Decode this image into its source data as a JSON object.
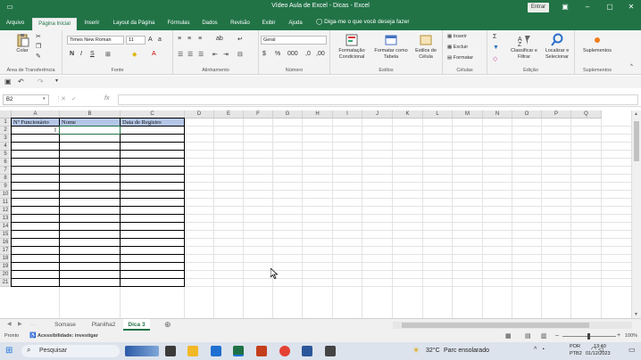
{
  "window": {
    "title": "Vídeo Aula de Excel - Dicas  -  Excel",
    "signin": "Entrar"
  },
  "ribbon_tabs": [
    "Arquivo",
    "Página Inicial",
    "Inserir",
    "Layout da Página",
    "Fórmulas",
    "Dados",
    "Revisão",
    "Exibir",
    "Ajuda"
  ],
  "tell_me": "Diga-me o que você deseja fazer",
  "ribbon": {
    "clipboard": {
      "paste": "Colar",
      "label": "Área de Transferência"
    },
    "font": {
      "name": "Times New Roman",
      "size": "11",
      "bold": "N",
      "italic": "I",
      "underline": "S",
      "label": "Fonte"
    },
    "alignment": {
      "label": "Alinhamento"
    },
    "number": {
      "format": "Geral",
      "label": "Número"
    },
    "styles": {
      "cond": "Formatação Condicional",
      "table": "Formatar como Tabela",
      "cell": "Estilos de Célula",
      "label": "Estilos"
    },
    "cells": {
      "insert": "Inserir",
      "delete": "Excluir",
      "format": "Formatar",
      "label": "Células"
    },
    "editing": {
      "sort": "Classificar e Filtrar",
      "find": "Localizar e Selecionar",
      "label": "Edição"
    },
    "addins": {
      "btn": "Suplementos",
      "label": "Suplementos"
    }
  },
  "name_box": "B2",
  "fx": "fx",
  "columns": [
    "A",
    "B",
    "C",
    "D",
    "E",
    "F",
    "G",
    "H",
    "I",
    "J",
    "K",
    "L",
    "M",
    "N",
    "O",
    "P",
    "Q"
  ],
  "rows": [
    "1",
    "2",
    "3",
    "4",
    "5",
    "6",
    "7",
    "8",
    "9",
    "10",
    "11",
    "12",
    "13",
    "14",
    "15",
    "16",
    "17",
    "18",
    "19",
    "20",
    "21"
  ],
  "table_headers": [
    "Nº Funcionário",
    "Nome",
    "Data de Registro"
  ],
  "sheets": [
    "Somase",
    "Planilha2",
    "Dica 3"
  ],
  "active_sheet": "Dica 3",
  "status": {
    "ready": "Pronto",
    "accessibility": "Acessibilidade: investigar",
    "zoom": "100%"
  },
  "taskbar": {
    "search": "Pesquisar",
    "weather_temp": "32°C",
    "weather_desc": "Parc ensolarado",
    "lang1": "POR",
    "lang2": "PTB2",
    "time": "13:40",
    "date": "01/12/2023"
  },
  "colors": {
    "excel_green": "#217346",
    "header_fill": "#b4c6e7"
  }
}
